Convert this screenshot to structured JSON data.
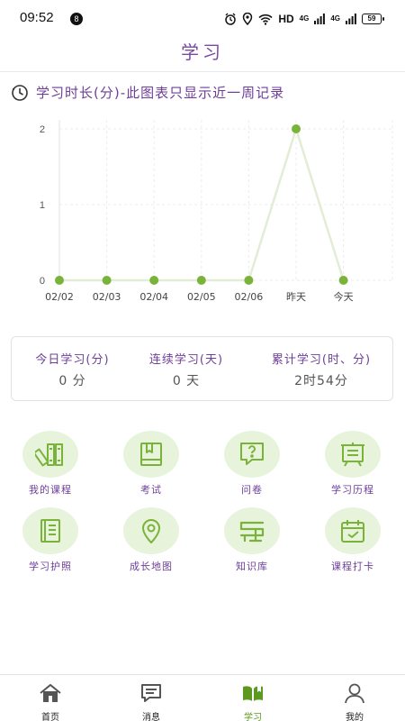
{
  "status_bar": {
    "time": "09:52",
    "notification_count": "8",
    "network_label": "HD",
    "network_sub": "4G",
    "battery": "59"
  },
  "header": {
    "title": "学习"
  },
  "chart_section": {
    "heading": "学习时长(分)-此图表只显示近一周记录",
    "icon": "clock-icon"
  },
  "chart_data": {
    "type": "line",
    "categories": [
      "02/02",
      "02/03",
      "02/04",
      "02/05",
      "02/06",
      "昨天",
      "今天"
    ],
    "values": [
      0,
      0,
      0,
      0,
      0,
      2,
      0
    ],
    "ylim": [
      0,
      2
    ],
    "yticks": [
      "0",
      "1",
      "2"
    ],
    "grid": true,
    "line_color": "#e3ecd6",
    "point_color": "#7ab33a",
    "title": "",
    "xlabel": "",
    "ylabel": ""
  },
  "stats": [
    {
      "label": "今日学习(分)",
      "value": "0 分"
    },
    {
      "label": "连续学习(天)",
      "value": "0 天"
    },
    {
      "label": "累计学习(时、分)",
      "value": "2时54分"
    }
  ],
  "grid_items": [
    {
      "label": "我的课程",
      "icon": "books-icon"
    },
    {
      "label": "考试",
      "icon": "exam-icon"
    },
    {
      "label": "问卷",
      "icon": "question-icon"
    },
    {
      "label": "学习历程",
      "icon": "history-icon"
    },
    {
      "label": "学习护照",
      "icon": "passport-icon"
    },
    {
      "label": "成长地图",
      "icon": "map-pin-icon"
    },
    {
      "label": "知识库",
      "icon": "knowledge-icon"
    },
    {
      "label": "课程打卡",
      "icon": "calendar-check-icon"
    }
  ],
  "bottom_nav": [
    {
      "label": "首页",
      "icon": "home-icon",
      "active": false
    },
    {
      "label": "消息",
      "icon": "message-icon",
      "active": false
    },
    {
      "label": "学习",
      "icon": "book-icon",
      "active": true
    },
    {
      "label": "我的",
      "icon": "user-icon",
      "active": false
    }
  ],
  "colors": {
    "accent_purple": "#6e3f98",
    "accent_green": "#7ab33a",
    "icon_bg": "#e8f3dc"
  }
}
